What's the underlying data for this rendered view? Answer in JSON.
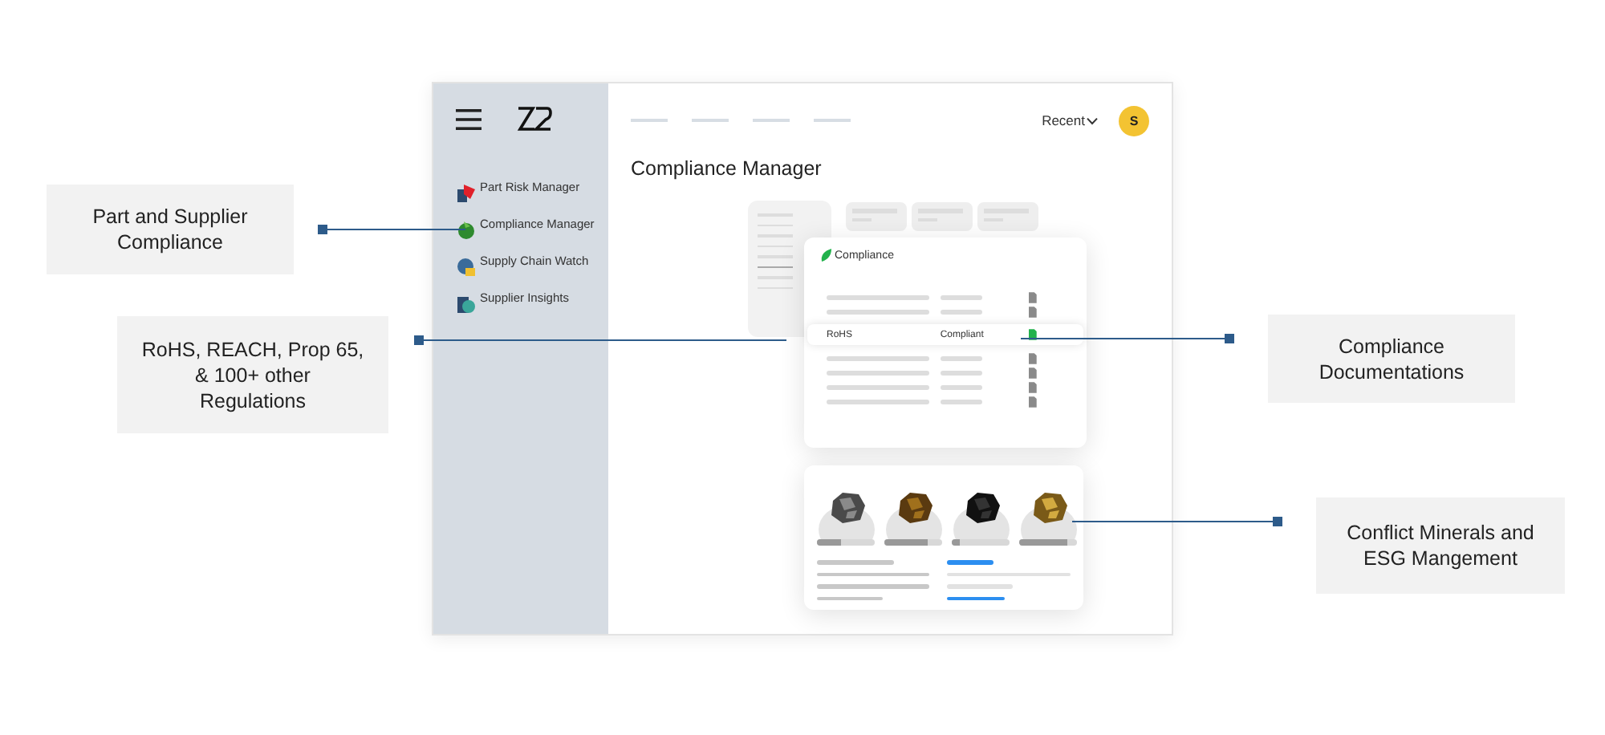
{
  "callouts": [
    {
      "text": "Part and Supplier Compliance"
    },
    {
      "text": "RoHS, REACH, Prop 65, & 100+ other Regulations"
    },
    {
      "text": "Compliance Documentations"
    },
    {
      "text": "Conflict Minerals and ESG Mangement"
    }
  ],
  "sidebar": {
    "items": [
      {
        "label": "Part Risk Manager",
        "kind": "risk"
      },
      {
        "label": "Compliance Manager",
        "kind": "compliance"
      },
      {
        "label": "Supply Chain Watch",
        "kind": "supply"
      },
      {
        "label": "Supplier Insights",
        "kind": "insights"
      }
    ]
  },
  "topbar": {
    "recent": "Recent",
    "avatar": "S"
  },
  "page_title": "Compliance Manager",
  "compliance_card": {
    "title": "Compliance",
    "rows": [
      {
        "selected": false
      },
      {
        "selected": false
      },
      {
        "name": "RoHS",
        "status": "Compliant",
        "selected": true
      },
      {
        "selected": false
      },
      {
        "selected": false
      },
      {
        "selected": false
      },
      {
        "selected": false
      }
    ]
  },
  "minerals": [
    {
      "kind": "picture",
      "level": 0.42
    },
    {
      "kind": "picture",
      "level": 0.75
    },
    {
      "kind": "picture",
      "level": 0.15
    },
    {
      "kind": "picture",
      "level": 0.83
    }
  ]
}
